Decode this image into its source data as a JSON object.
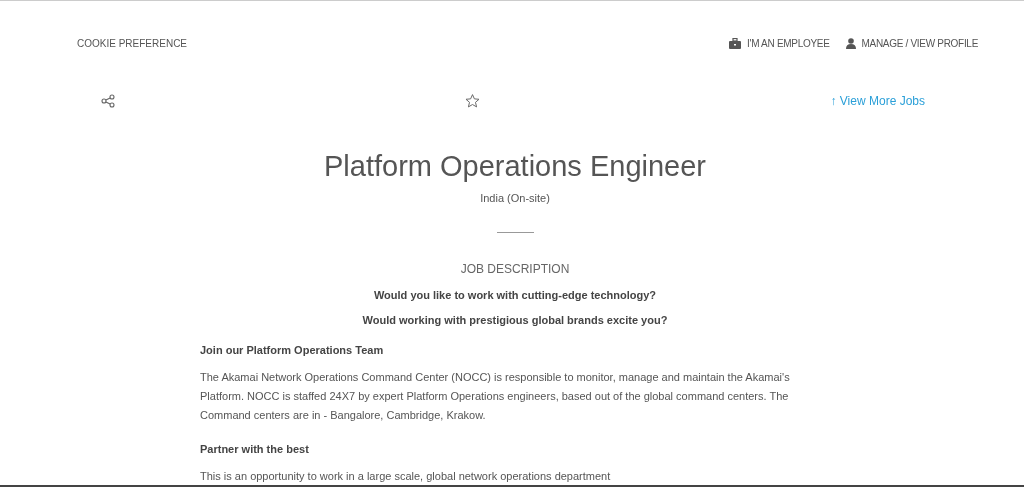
{
  "header": {
    "cookie_link": "COOKIE PREFERENCE",
    "nav": [
      {
        "kind": "employee",
        "label": "I'M AN EMPLOYEE"
      },
      {
        "kind": "profile",
        "label": "MANAGE / VIEW PROFILE"
      }
    ]
  },
  "toolbar": {
    "view_more": "↑ View More Jobs"
  },
  "job": {
    "title": "Platform Operations Engineer",
    "location": "India (On-site)",
    "section_title": "JOB DESCRIPTION",
    "blocks": [
      {
        "kind": "lead",
        "text": "Would you like to work with cutting-edge technology?"
      },
      {
        "kind": "lead",
        "text": "Would working with prestigious global brands excite you?"
      },
      {
        "kind": "heading",
        "text": "Join our Platform Operations Team"
      },
      {
        "kind": "paragraph",
        "text": "The Akamai Network Operations Command Center (NOCC) is responsible to monitor, manage and maintain the Akamai's Platform. NOCC is staffed 24X7 by expert Platform Operations engineers, based out of the global command centers. The Command centers are in - Bangalore, Cambridge, Krakow."
      },
      {
        "kind": "heading",
        "text": "Partner with the best"
      },
      {
        "kind": "paragraph",
        "text": "This is an opportunity to work in a large scale, global network operations department"
      }
    ]
  }
}
